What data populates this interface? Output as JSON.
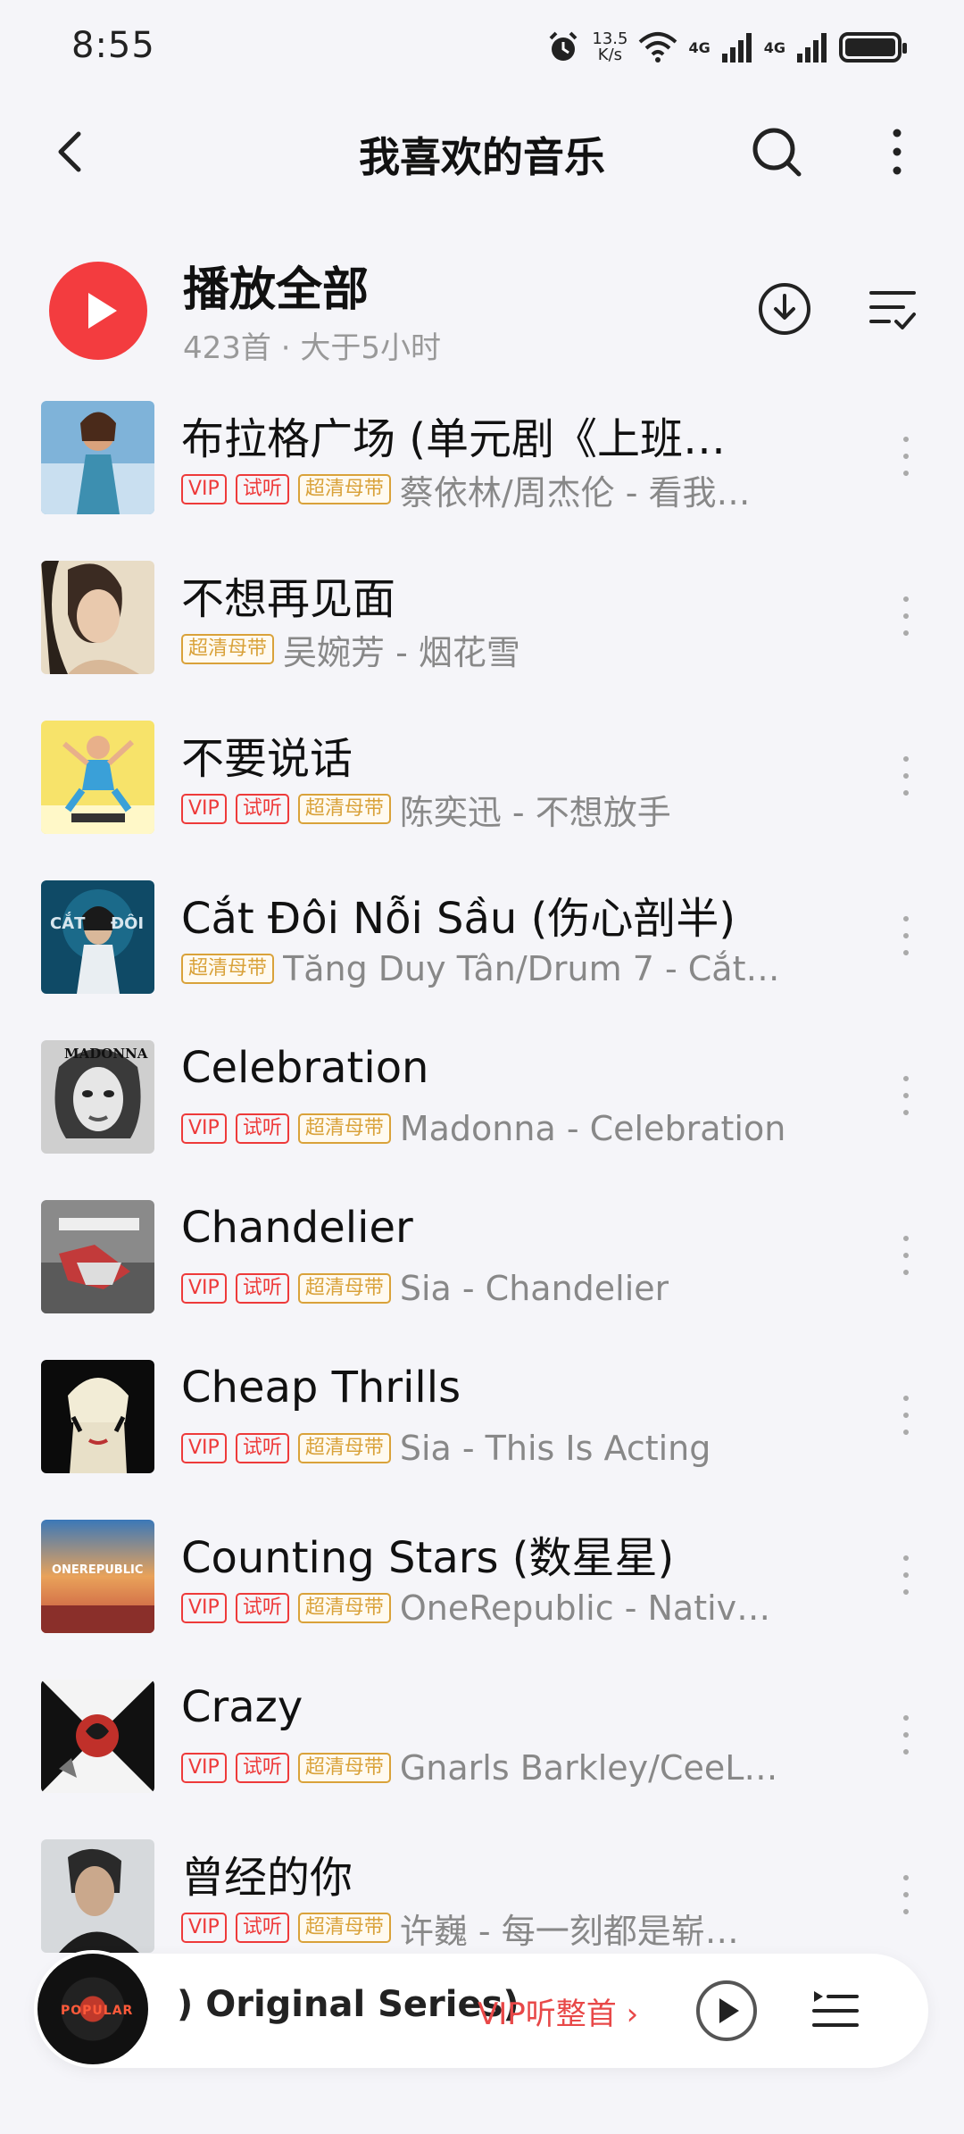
{
  "status_bar": {
    "time": "8:55",
    "speed_top": "13.5",
    "speed_bottom": "K/s",
    "net1": "4G",
    "net2": "4G",
    "icons": [
      "alarm-icon",
      "wifi-icon",
      "signal-icon",
      "battery-icon"
    ]
  },
  "header": {
    "title": "我喜欢的音乐",
    "icons": [
      "back-icon",
      "search-icon",
      "more-icon"
    ]
  },
  "play_all": {
    "label": "播放全部",
    "subtitle": "423首 · 大于5小时",
    "accent": "#f33c3f"
  },
  "tags": {
    "vip": "VIP",
    "trial": "试听",
    "hq": "超清母带"
  },
  "songs": [
    {
      "title": "布拉格广场 (单元剧《上班…",
      "artist": "蔡依林/周杰伦 - 看我…",
      "vip": true,
      "trial": true,
      "hq": true
    },
    {
      "title": "不想再见面",
      "artist": "吴婉芳 - 烟花雪",
      "vip": false,
      "trial": false,
      "hq": true
    },
    {
      "title": "不要说话",
      "artist": "陈奕迅 - 不想放手",
      "vip": true,
      "trial": true,
      "hq": true
    },
    {
      "title": "Cắt Đôi Nỗi Sầu (伤心剖半)",
      "artist": "Tăng Duy Tân/Drum 7 - Cắt …",
      "vip": false,
      "trial": false,
      "hq": true
    },
    {
      "title": "Celebration",
      "artist": "Madonna - Celebration",
      "vip": true,
      "trial": true,
      "hq": true
    },
    {
      "title": "Chandelier",
      "artist": "Sia - Chandelier",
      "vip": true,
      "trial": true,
      "hq": true
    },
    {
      "title": "Cheap Thrills",
      "artist": "Sia - This Is Acting",
      "vip": true,
      "trial": true,
      "hq": true
    },
    {
      "title": "Counting Stars (数星星)",
      "artist": "OneRepublic - Nativ…",
      "vip": true,
      "trial": true,
      "hq": true
    },
    {
      "title": "Crazy",
      "artist": "Gnarls Barkley/CeeL…",
      "vip": true,
      "trial": true,
      "hq": true
    },
    {
      "title": "曾经的你",
      "artist": "许巍 - 每一刻都是崭…",
      "vip": true,
      "trial": true,
      "hq": true
    }
  ],
  "mini_player": {
    "title": ") Original Series)",
    "vip_text": "VIP听整首 ›",
    "disc_label": "POPULAR",
    "icons": [
      "play-icon",
      "playlist-icon"
    ]
  }
}
